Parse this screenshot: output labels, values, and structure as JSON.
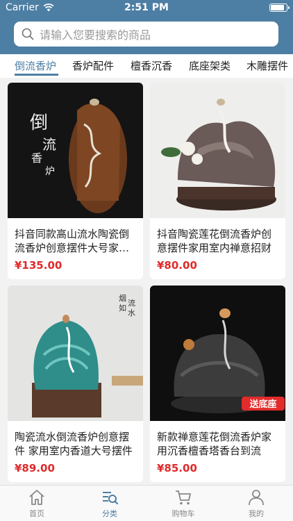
{
  "status_bar": {
    "carrier": "Carrier",
    "time": "2:51 PM"
  },
  "search": {
    "placeholder": "请输入您要搜索的商品"
  },
  "category_tabs": [
    {
      "label": "倒流香炉",
      "active": true
    },
    {
      "label": "香炉配件",
      "active": false
    },
    {
      "label": "檀香沉香",
      "active": false
    },
    {
      "label": "底座架类",
      "active": false
    },
    {
      "label": "木雕摆件",
      "active": false
    }
  ],
  "products": [
    {
      "title": "抖音同款高山流水陶瓷倒流香炉创意摆件大号家用室内",
      "price": "¥135.00",
      "image_text": [
        "倒",
        "流",
        "香",
        "炉"
      ]
    },
    {
      "title": "抖音陶瓷莲花倒流香炉创意摆件家用室内禅意招财",
      "price": "¥80.00"
    },
    {
      "title": "陶瓷流水倒流香炉创意摆件 家用室内香道大号摆件",
      "price": "¥89.00",
      "image_text": [
        "烟",
        "如",
        "流",
        "水"
      ]
    },
    {
      "title": "新款禅意莲花倒流香炉家用沉香檀香塔香台到流",
      "price": "¥85.00",
      "badge": "送底座"
    }
  ],
  "tabbar": [
    {
      "label": "首页",
      "icon": "home-icon",
      "active": false
    },
    {
      "label": "分类",
      "icon": "category-icon",
      "active": true
    },
    {
      "label": "购物车",
      "icon": "cart-icon",
      "active": false
    },
    {
      "label": "我的",
      "icon": "profile-icon",
      "active": false
    }
  ],
  "colors": {
    "primary": "#4d7ea3",
    "price": "#e02a2a",
    "background": "#f2f2f2"
  }
}
